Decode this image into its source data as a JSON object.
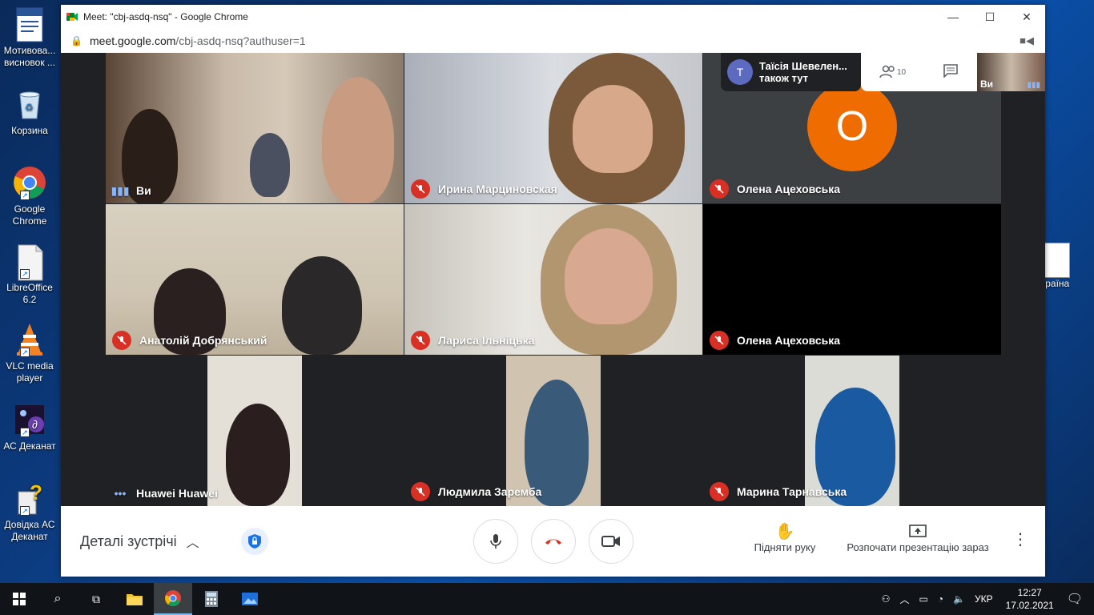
{
  "desktop": {
    "icons": [
      {
        "label": "Мотивова... висновок ..."
      },
      {
        "label": "Корзина"
      },
      {
        "label": "Google Chrome"
      },
      {
        "label": "LibreOffice 6.2"
      },
      {
        "label": "VLC media player"
      },
      {
        "label": "АС Деканат"
      },
      {
        "label": "Довідка АС Деканат"
      }
    ],
    "right_icon": {
      "label": "країна"
    }
  },
  "window": {
    "title": "Meet: \"cbj-asdq-nsq\" - Google Chrome",
    "url_host": "meet.google.com",
    "url_path": "/cbj-asdq-nsq?authuser=1"
  },
  "meet": {
    "notification": {
      "avatar_letter": "Т",
      "name": "Таїсія Шевелен...",
      "text": "також тут"
    },
    "participants_count": "10",
    "self_label": "Ви",
    "tiles": [
      {
        "name": "Ви"
      },
      {
        "name": "Ирина Марциновская"
      },
      {
        "name": "Олена Ацеховська",
        "avatar": "О"
      },
      {
        "name": "Анатолій Добрянський"
      },
      {
        "name": "Лариса Ільніцька"
      },
      {
        "name": "Олена Ацеховська"
      },
      {
        "name": "Huawei Huawei"
      },
      {
        "name": "Людмила Заремба"
      },
      {
        "name": "Марина Тарнавська"
      }
    ],
    "bottom": {
      "details": "Деталі зустрічі",
      "raise_hand": "Підняти руку",
      "present": "Розпочати презентацію зараз"
    }
  },
  "taskbar": {
    "lang": "УКР",
    "time": "12:27",
    "date": "17.02.2021"
  },
  "colors": {
    "mute_red": "#d93025",
    "avatar_orange": "#ef6c00",
    "meet_dark": "#202124"
  }
}
